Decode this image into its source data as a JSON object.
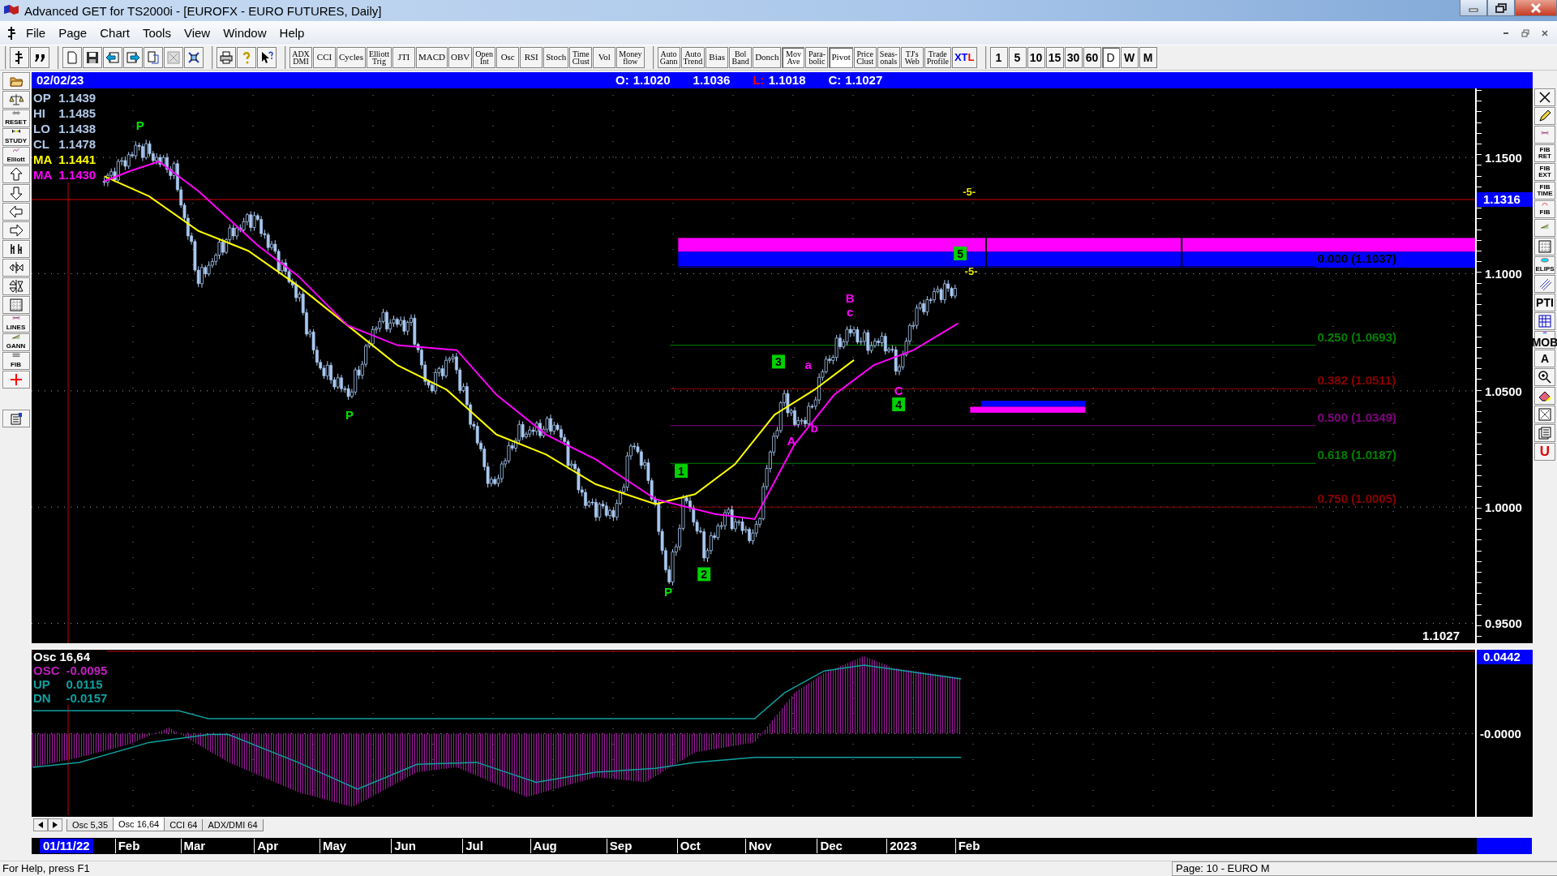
{
  "window": {
    "title": "Advanced GET for TS2000i - [EUROFX - EURO FUTURES, Daily]"
  },
  "menu": [
    "File",
    "Page",
    "Chart",
    "Tools",
    "View",
    "Window",
    "Help"
  ],
  "indicator_buttons": [
    {
      "lines": [
        "ADX",
        "DMI"
      ],
      "pressed": false
    },
    {
      "lines": [
        "CCI"
      ],
      "pressed": false
    },
    {
      "lines": [
        "Cycles"
      ],
      "pressed": false
    },
    {
      "lines": [
        "Elliott",
        "Trig"
      ],
      "pressed": false
    },
    {
      "lines": [
        "JTI"
      ],
      "pressed": false
    },
    {
      "lines": [
        "MACD"
      ],
      "pressed": false
    },
    {
      "lines": [
        "OBV"
      ],
      "pressed": false
    },
    {
      "lines": [
        "Open",
        "Int"
      ],
      "pressed": false
    },
    {
      "lines": [
        "Osc"
      ],
      "pressed": false
    },
    {
      "lines": [
        "RSI"
      ],
      "pressed": false
    },
    {
      "lines": [
        "Stoch"
      ],
      "pressed": false
    },
    {
      "lines": [
        "Time",
        "Clust"
      ],
      "pressed": false
    },
    {
      "lines": [
        "Vol"
      ],
      "pressed": false
    },
    {
      "lines": [
        "Money",
        "flow"
      ],
      "pressed": false
    }
  ],
  "study_buttons": [
    {
      "lines": [
        "Auto",
        "Gann"
      ],
      "pressed": false
    },
    {
      "lines": [
        "Auto",
        "Trend"
      ],
      "pressed": false
    },
    {
      "lines": [
        "Bias"
      ],
      "pressed": false
    },
    {
      "lines": [
        "Bol",
        "Band"
      ],
      "pressed": false
    },
    {
      "lines": [
        "Donch"
      ],
      "pressed": false
    },
    {
      "lines": [
        "Mov",
        "Ave"
      ],
      "pressed": true
    },
    {
      "lines": [
        "Para-",
        "bolic"
      ],
      "pressed": false
    },
    {
      "lines": [
        "Pivot"
      ],
      "pressed": true
    },
    {
      "lines": [
        "Price",
        "Clust"
      ],
      "pressed": false
    },
    {
      "lines": [
        "Seas-",
        "onals"
      ],
      "pressed": false
    },
    {
      "lines": [
        "TJ's",
        "Web"
      ],
      "pressed": false
    },
    {
      "lines": [
        "Trade",
        "Profile"
      ],
      "pressed": false
    },
    {
      "parts": [
        {
          "text": "X",
          "color": "#0000ff"
        },
        {
          "text": "T",
          "color": "#0000ff"
        },
        {
          "text": "L",
          "color": "#ff0000"
        }
      ],
      "pressed": false
    }
  ],
  "timeframes": [
    {
      "label": "1",
      "selected": false
    },
    {
      "label": "5",
      "selected": false
    },
    {
      "label": "10",
      "selected": false
    },
    {
      "label": "15",
      "selected": false
    },
    {
      "label": "30",
      "selected": false
    },
    {
      "label": "60",
      "selected": false
    },
    {
      "label": "D",
      "selected": true
    },
    {
      "label": "W",
      "selected": false
    },
    {
      "label": "M",
      "selected": false
    }
  ],
  "left_toolbar": {
    "labels": [
      "RESET",
      "STUDY",
      "Elliott",
      "LINES",
      "GANN",
      "FIB"
    ]
  },
  "right_toolbar": {
    "labels": [
      [
        "FIB",
        "RET"
      ],
      [
        "FIB",
        "EXT"
      ],
      [
        "FIB",
        "TIME"
      ],
      [
        "FIB"
      ],
      [
        "ELIPS"
      ],
      [
        "PTI"
      ],
      [
        "MOB"
      ],
      [
        "A"
      ],
      [
        "U"
      ]
    ]
  },
  "info_bar": {
    "date": "02/02/23",
    "fields": [
      {
        "label": "O:",
        "value": "1.1020",
        "color": "#ffffff"
      },
      {
        "value": "1.1036"
      },
      {
        "label": "L:",
        "value": "1.1018",
        "color": "#ff0000"
      },
      {
        "label": "C:",
        "value": "1.1027",
        "color": "#ffffff"
      }
    ]
  },
  "price_chart": {
    "legend": [
      {
        "label": "OP",
        "value": "1.1439",
        "color": "#b0c8e8"
      },
      {
        "label": "HI",
        "value": "1.1485",
        "color": "#b0c8e8"
      },
      {
        "label": "LO",
        "value": "1.1438",
        "color": "#b0c8e8"
      },
      {
        "label": "CL",
        "value": "1.1478",
        "color": "#b0c8e8"
      },
      {
        "label": "MA",
        "value": "1.1441",
        "color": "#ffff00"
      },
      {
        "label": "MA",
        "value": "1.1430",
        "color": "#ff00ff"
      }
    ],
    "wave_labels": [
      {
        "text": "P",
        "kind": "pivot"
      },
      {
        "text": "P",
        "kind": "pivot"
      },
      {
        "text": "1",
        "kind": "box"
      },
      {
        "text": "P",
        "kind": "pivot"
      },
      {
        "text": "2",
        "kind": "box"
      },
      {
        "text": "3",
        "kind": "box"
      },
      {
        "text": "A",
        "kind": "letter"
      },
      {
        "text": "a",
        "kind": "letter"
      },
      {
        "text": "b",
        "kind": "letter"
      },
      {
        "text": "B",
        "kind": "letter"
      },
      {
        "text": "c",
        "kind": "letter"
      },
      {
        "text": "4",
        "kind": "box"
      },
      {
        "text": "C",
        "kind": "letter"
      },
      {
        "text": "5",
        "kind": "box"
      }
    ],
    "projection_labels": [
      "-5-",
      "-5-"
    ],
    "fib_levels": [
      {
        "text": "0.000 (1.1037)",
        "color": "#000000"
      },
      {
        "text": "0.250 (1.0693)",
        "color": "#008000"
      },
      {
        "text": "0.382 (1.0511)",
        "color": "#8b0000"
      },
      {
        "text": "0.500 (1.0349)",
        "color": "#800080"
      },
      {
        "text": "0.618 (1.0187)",
        "color": "#008000"
      },
      {
        "text": "0.750 (1.0005)",
        "color": "#8b0000"
      }
    ],
    "last_price": "1.1027",
    "axis_labels": [
      "1.1500",
      "1.1000",
      "1.0500",
      "1.0000",
      "0.9500"
    ],
    "marker": "1.1316"
  },
  "oscillator": {
    "title": "Osc 16,64",
    "legend": [
      {
        "label": "OSC",
        "value": "-0.0095",
        "color": "#c020c0"
      },
      {
        "label": "UP",
        "value": "0.0115",
        "color": "#10a0a0"
      },
      {
        "label": "DN",
        "value": "-0.0157",
        "color": "#10a0a0"
      }
    ],
    "marker": "0.0442",
    "axis_labels": [
      "-0.0000"
    ]
  },
  "study_tabs": [
    {
      "label": "Osc 5,35",
      "selected": false
    },
    {
      "label": "Osc 16,64",
      "selected": true
    },
    {
      "label": "CCI 64",
      "selected": false
    },
    {
      "label": "ADX/DMI 64",
      "selected": false
    }
  ],
  "date_axis": {
    "start": "01/11/22",
    "labels": [
      "Feb",
      "Mar",
      "Apr",
      "May",
      "Jun",
      "Jul",
      "Aug",
      "Sep",
      "Oct",
      "Nov",
      "Dec",
      "2023",
      "Feb"
    ]
  },
  "status_bar": {
    "help": "For Help, press F1",
    "page": "Page: 10 - EURO M"
  }
}
